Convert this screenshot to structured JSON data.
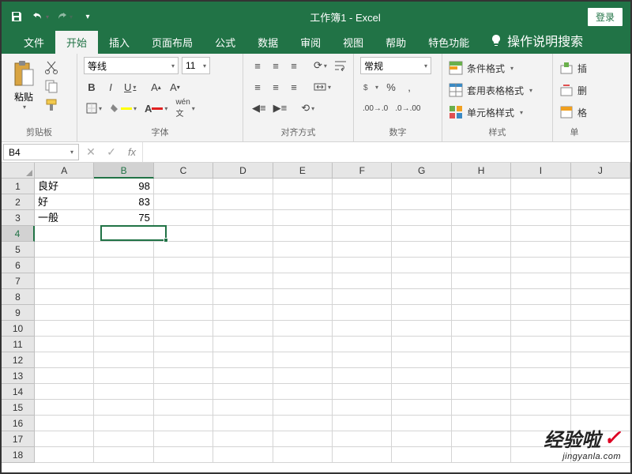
{
  "title": "工作簿1 - Excel",
  "login": "登录",
  "tabs": [
    "文件",
    "开始",
    "插入",
    "页面布局",
    "公式",
    "数据",
    "审阅",
    "视图",
    "帮助",
    "特色功能"
  ],
  "active_tab": 1,
  "tell_me": "操作说明搜索",
  "groups": {
    "clipboard": {
      "label": "剪贴板",
      "paste": "粘贴"
    },
    "font": {
      "label": "字体",
      "name": "等线",
      "size": "11"
    },
    "align": {
      "label": "对齐方式"
    },
    "number": {
      "label": "数字",
      "format": "常规"
    },
    "styles": {
      "label": "样式",
      "cond": "条件格式",
      "table": "套用表格格式",
      "cell": "单元格样式"
    },
    "cells": {
      "label": "单",
      "insert": "插",
      "delete": "删",
      "format": "格"
    }
  },
  "name_box": "B4",
  "formula": "",
  "columns": [
    "A",
    "B",
    "C",
    "D",
    "E",
    "F",
    "G",
    "H",
    "I",
    "J"
  ],
  "row_count": 18,
  "selected": {
    "col": 1,
    "row": 3
  },
  "sheet": {
    "rows": [
      {
        "A": "良好",
        "B": "98"
      },
      {
        "A": "好",
        "B": "83"
      },
      {
        "A": "一般",
        "B": "75"
      }
    ]
  },
  "watermark": {
    "main": "经验啦",
    "sub": "jingyanla.com"
  }
}
